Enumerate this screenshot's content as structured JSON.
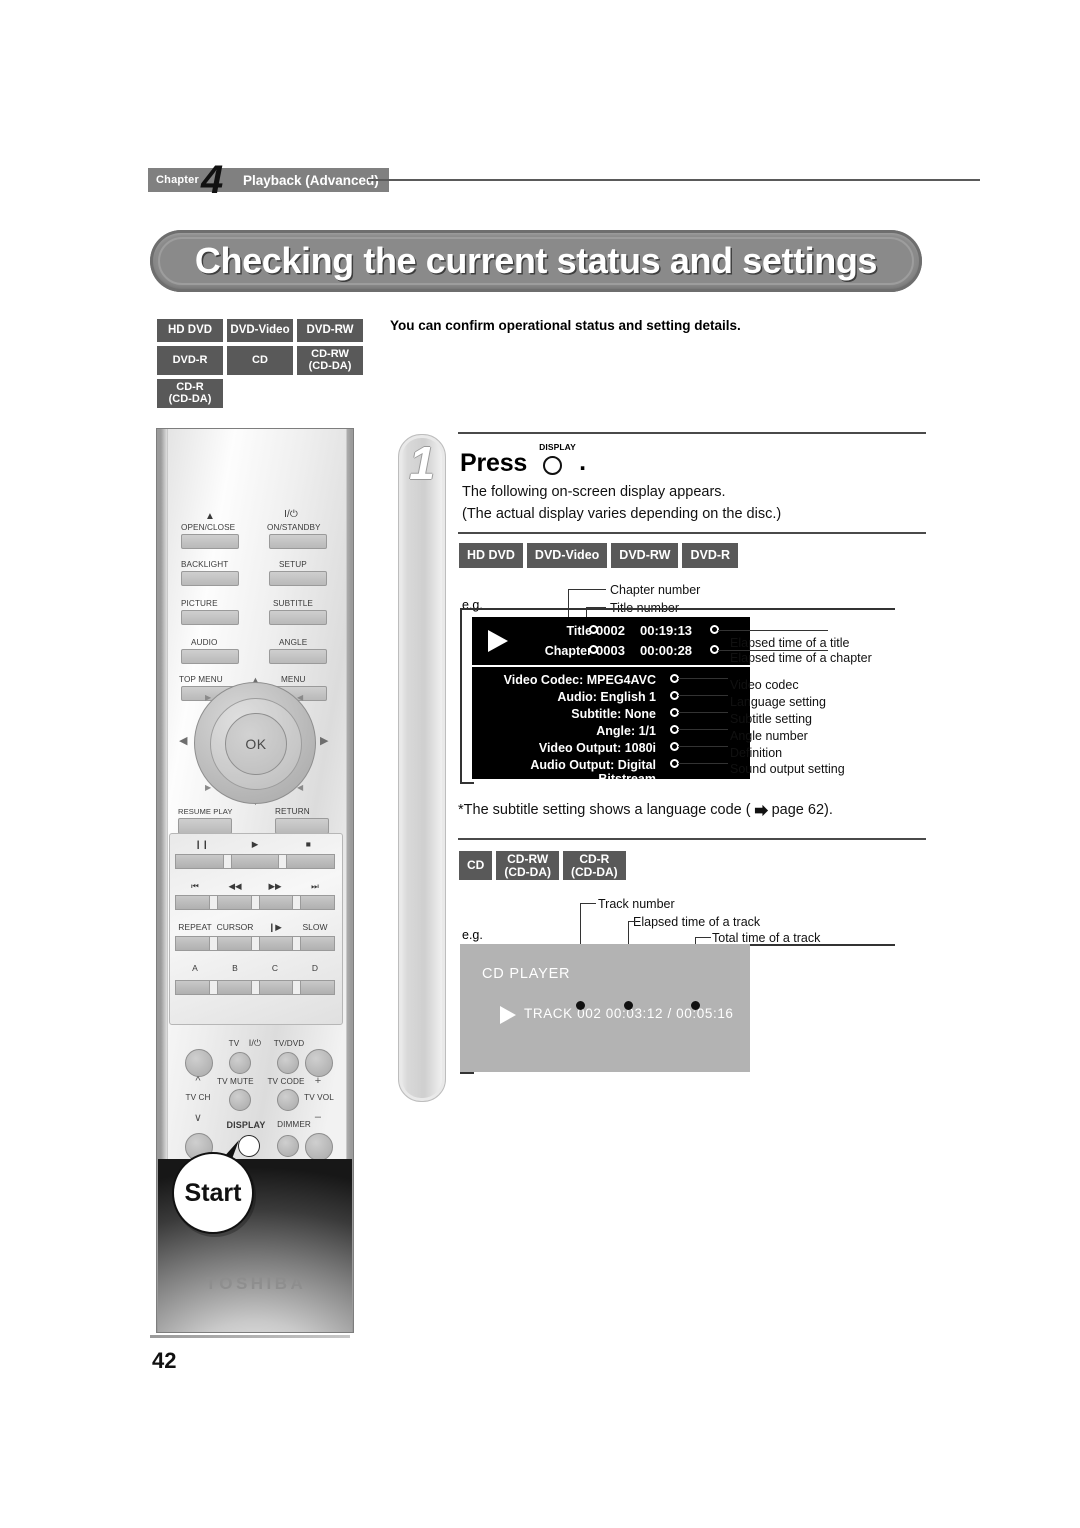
{
  "header": {
    "chapter_word": "Chapter",
    "chapter_number": "4",
    "chapter_title": "Playback (Advanced)"
  },
  "page_title": "Checking the current status and settings",
  "page_number": "42",
  "disc_matrix": [
    [
      "HD DVD",
      "DVD-Video",
      "DVD-RW"
    ],
    [
      "DVD-R",
      "CD",
      "CD-RW\n(CD-DA)"
    ],
    [
      "CD-R\n(CD-DA)"
    ]
  ],
  "disc_matrix_flat": {
    "hd_dvd": "HD DVD",
    "dvd_video": "DVD-Video",
    "dvd_rw": "DVD-RW",
    "dvd_r": "DVD-R",
    "cd": "CD",
    "cd_rw_l1": "CD-RW",
    "cd_rw_l2": "(CD-DA)",
    "cd_r_l1": "CD-R",
    "cd_r_l2": "(CD-DA)"
  },
  "intro_text": "You can confirm operational status and setting details.",
  "step": {
    "number": "1",
    "press_word": "Press",
    "key_caption": "DISPLAY",
    "period": ".",
    "body_line_1": "The following on-screen display appears.",
    "body_line_2": "(The actual display varies depending on the disc.)"
  },
  "video_disc_badges": [
    "HD DVD",
    "DVD-Video",
    "DVD-RW",
    "DVD-R"
  ],
  "eg_label": "e.g.",
  "video_osd": {
    "callout_chapter_number": "Chapter number",
    "callout_title_number": "Title number",
    "title_label": "Title",
    "title_value": "0002",
    "title_time": "00:19:13",
    "chapter_label": "Chapter",
    "chapter_value": "0003",
    "chapter_time": "00:00:28",
    "rows": [
      {
        "text": "Video Codec: MPEG4AVC",
        "callout": "Video codec"
      },
      {
        "text": "Audio: English 1",
        "callout": "Language setting"
      },
      {
        "text": "Subtitle: None",
        "callout": "Subtitle setting"
      },
      {
        "text": "Angle: 1/1",
        "callout": "Angle number"
      },
      {
        "text": "Video Output: 1080i",
        "callout": "Definition"
      },
      {
        "text": "Audio Output: Digital Bitstream",
        "callout": "Sound output setting"
      }
    ],
    "callout_elapsed_title": "Elapsed time of a title",
    "callout_elapsed_chapter": "Elapsed time of a chapter"
  },
  "subtitle_note": {
    "before": "*The subtitle setting shows a language code (",
    "arrow_icon": "right-arrow-page-icon",
    "after": "page 62)."
  },
  "cd_disc_badges": {
    "cd": "CD",
    "cd_rw_l1": "CD-RW",
    "cd_rw_l2": "(CD-DA)",
    "cd_r_l1": "CD-R",
    "cd_r_l2": "(CD-DA)"
  },
  "cd_osd": {
    "callout_track_number": "Track number",
    "callout_elapsed": "Elapsed time of a track",
    "callout_total": "Total time of a track",
    "screen_label": "CD PLAYER",
    "track_line": "TRACK  002  00:03:12 / 00:05:16"
  },
  "remote": {
    "brand": "TOSHIBA",
    "buttons": {
      "open_close": "OPEN/CLOSE",
      "on_standby": "ON/STANDBY",
      "backlight": "BACKLIGHT",
      "setup": "SETUP",
      "picture": "PICTURE",
      "subtitle": "SUBTITLE",
      "audio": "AUDIO",
      "angle": "ANGLE",
      "top_menu": "TOP MENU",
      "menu": "MENU",
      "ok": "OK",
      "resume_play": "RESUME PLAY",
      "return": "RETURN",
      "repeat": "REPEAT",
      "cursor": "CURSOR",
      "slow": "SLOW",
      "color_a": "A",
      "color_b": "B",
      "color_c": "C",
      "color_d": "D",
      "tv_power": "TV",
      "tv_dvd": "TV/DVD",
      "tv_mute": "TV MUTE",
      "tv_code": "TV CODE",
      "display": "DISPLAY",
      "dimmer": "DIMMER",
      "tv_ch": "TV CH",
      "tv_vol": "TV VOL",
      "plus": "+",
      "minus": "–",
      "power_glyph": "I/⏻",
      "eject_glyph": "▲",
      "pause_glyph": "❙❙",
      "play_glyph": "▶",
      "stop_glyph": "■",
      "prev_glyph": "⏮",
      "rew_glyph": "◀◀",
      "ff_glyph": "▶▶",
      "next_glyph": "⏭",
      "step_glyph": "❙▶"
    }
  },
  "start_callout": "Start",
  "colors": {
    "badge_bg": "#595959",
    "header_bg": "#808080",
    "banner_bg": "#8a8a8a",
    "osd_bg": "#000000",
    "cd_screen_bg": "#b3b3b3"
  }
}
